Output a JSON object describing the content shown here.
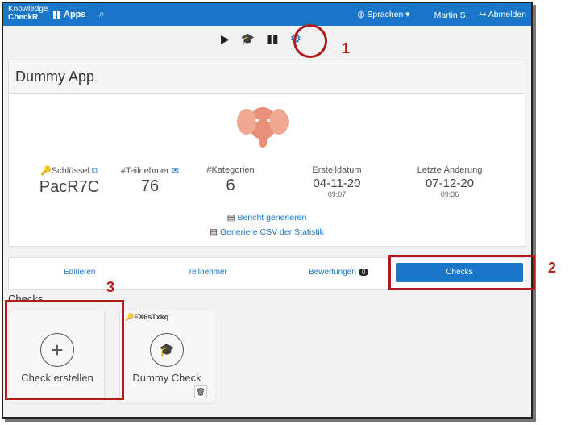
{
  "topbar": {
    "brand_line1": "Knowledge",
    "brand_line2": "CheckR",
    "apps_label": "Apps",
    "search_icon": "search-icon",
    "nav": [
      "Sprachen ▾",
      "Martin S.",
      "Abmelden"
    ]
  },
  "iconbar": [
    "play-icon",
    "graduation-cap-icon",
    "bar-chart-icon",
    "gear-icon"
  ],
  "app": {
    "title": "Dummy App",
    "stats": [
      {
        "label": "Schlüssel",
        "value": "PacR7C"
      },
      {
        "label": "#Teilnehmer",
        "value": "76"
      },
      {
        "label": "#Kategorien",
        "value": "6"
      },
      {
        "label": "Erstelldatum",
        "value": "04-11-20",
        "sub": "09:07"
      },
      {
        "label": "Letzte Änderung",
        "value": "07-12-20",
        "sub": "09:36"
      }
    ],
    "links": [
      "Bericht generieren",
      "Generiere CSV der Statistik"
    ]
  },
  "tabs": [
    {
      "label": "Editieren"
    },
    {
      "label": "Teilnehmer"
    },
    {
      "label": "Bewertungen",
      "badge": "0"
    },
    {
      "label": "Checks"
    }
  ],
  "checks": {
    "title": "Checks",
    "create_label": "Check erstellen",
    "items": [
      {
        "key": "EX6sTxkq",
        "name": "Dummy Check"
      }
    ]
  },
  "annotations": [
    "1",
    "2",
    "3"
  ],
  "colors": {
    "accent": "#1976c8",
    "annotation": "#b01c1c"
  }
}
